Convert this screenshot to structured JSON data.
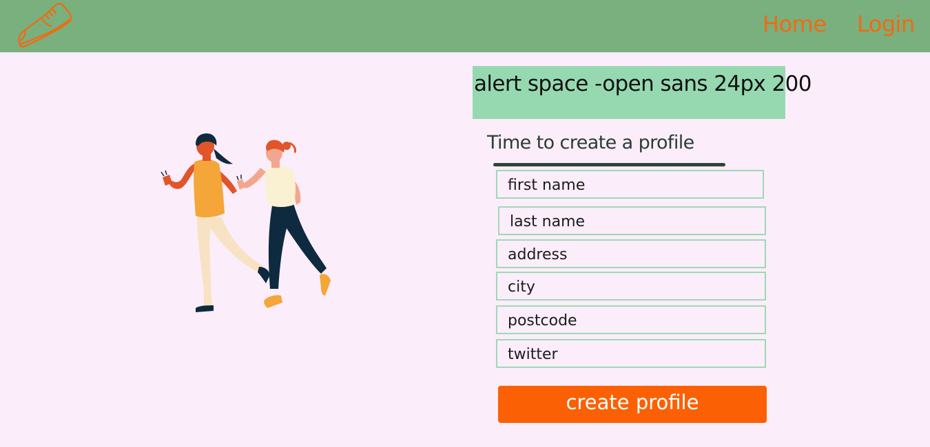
{
  "header": {
    "logo_icon": "sneaker-icon",
    "nav": {
      "home_label": "Home",
      "login_label": "Login"
    }
  },
  "alert": {
    "text": "alert space -open sans 24px 200"
  },
  "form": {
    "title": "Time to create a profile",
    "fields": [
      {
        "placeholder": "first name"
      },
      {
        "placeholder": "last name"
      },
      {
        "placeholder": "address"
      },
      {
        "placeholder": "city"
      },
      {
        "placeholder": "postcode"
      },
      {
        "placeholder": "twitter"
      }
    ],
    "submit_label": "create profile"
  },
  "colors": {
    "header_bg": "#7aaf7e",
    "page_bg": "#fbedf9",
    "accent_orange": "#fb6104",
    "alert_bg": "#96d9b1",
    "field_border": "#9dd9b7"
  }
}
